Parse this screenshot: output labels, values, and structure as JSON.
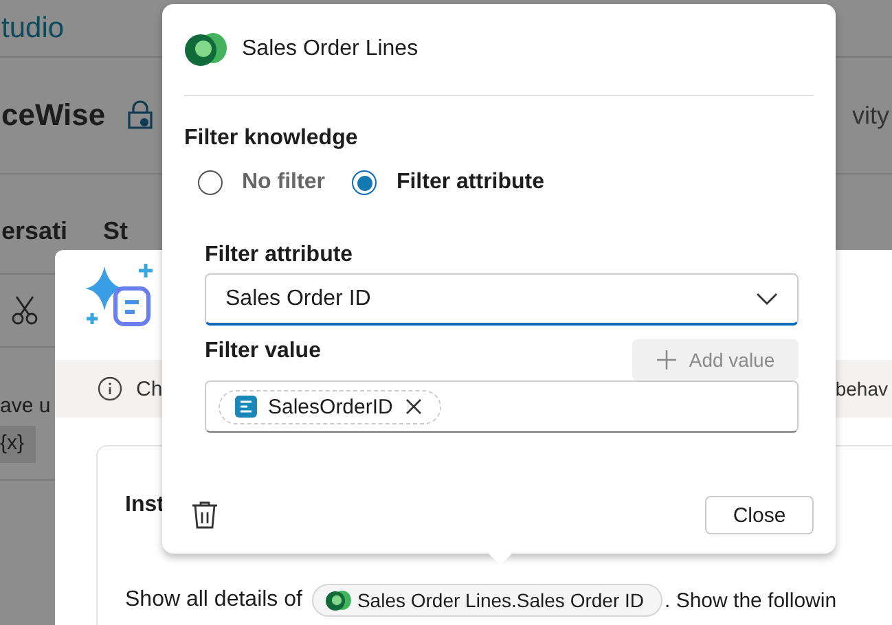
{
  "background": {
    "app_title": "tudio",
    "agent_name": "ceWise",
    "tab_1": "ersati",
    "tab_2": "St",
    "field_label": "ave u",
    "variable_chip": "{x}",
    "right_tab": "vity"
  },
  "dialog": {
    "info_text": "Ch",
    "info_text_right": "behav",
    "card_title": "Inst",
    "instruction_before": "Show all details of",
    "instruction_chip": "Sales Order Lines.Sales Order ID",
    "instruction_after": ".  Show the followin"
  },
  "popover": {
    "title": "Sales Order Lines",
    "section": "Filter knowledge",
    "options": [
      {
        "label": "No filter",
        "selected": false
      },
      {
        "label": "Filter attribute",
        "selected": true
      }
    ],
    "attribute_label": "Filter attribute",
    "attribute_value": "Sales Order ID",
    "value_label": "Filter value",
    "add_value": {
      "label": "Add value",
      "disabled": true
    },
    "value_tokens": [
      {
        "label": "SalesOrderID"
      }
    ],
    "close_button": "Close"
  }
}
